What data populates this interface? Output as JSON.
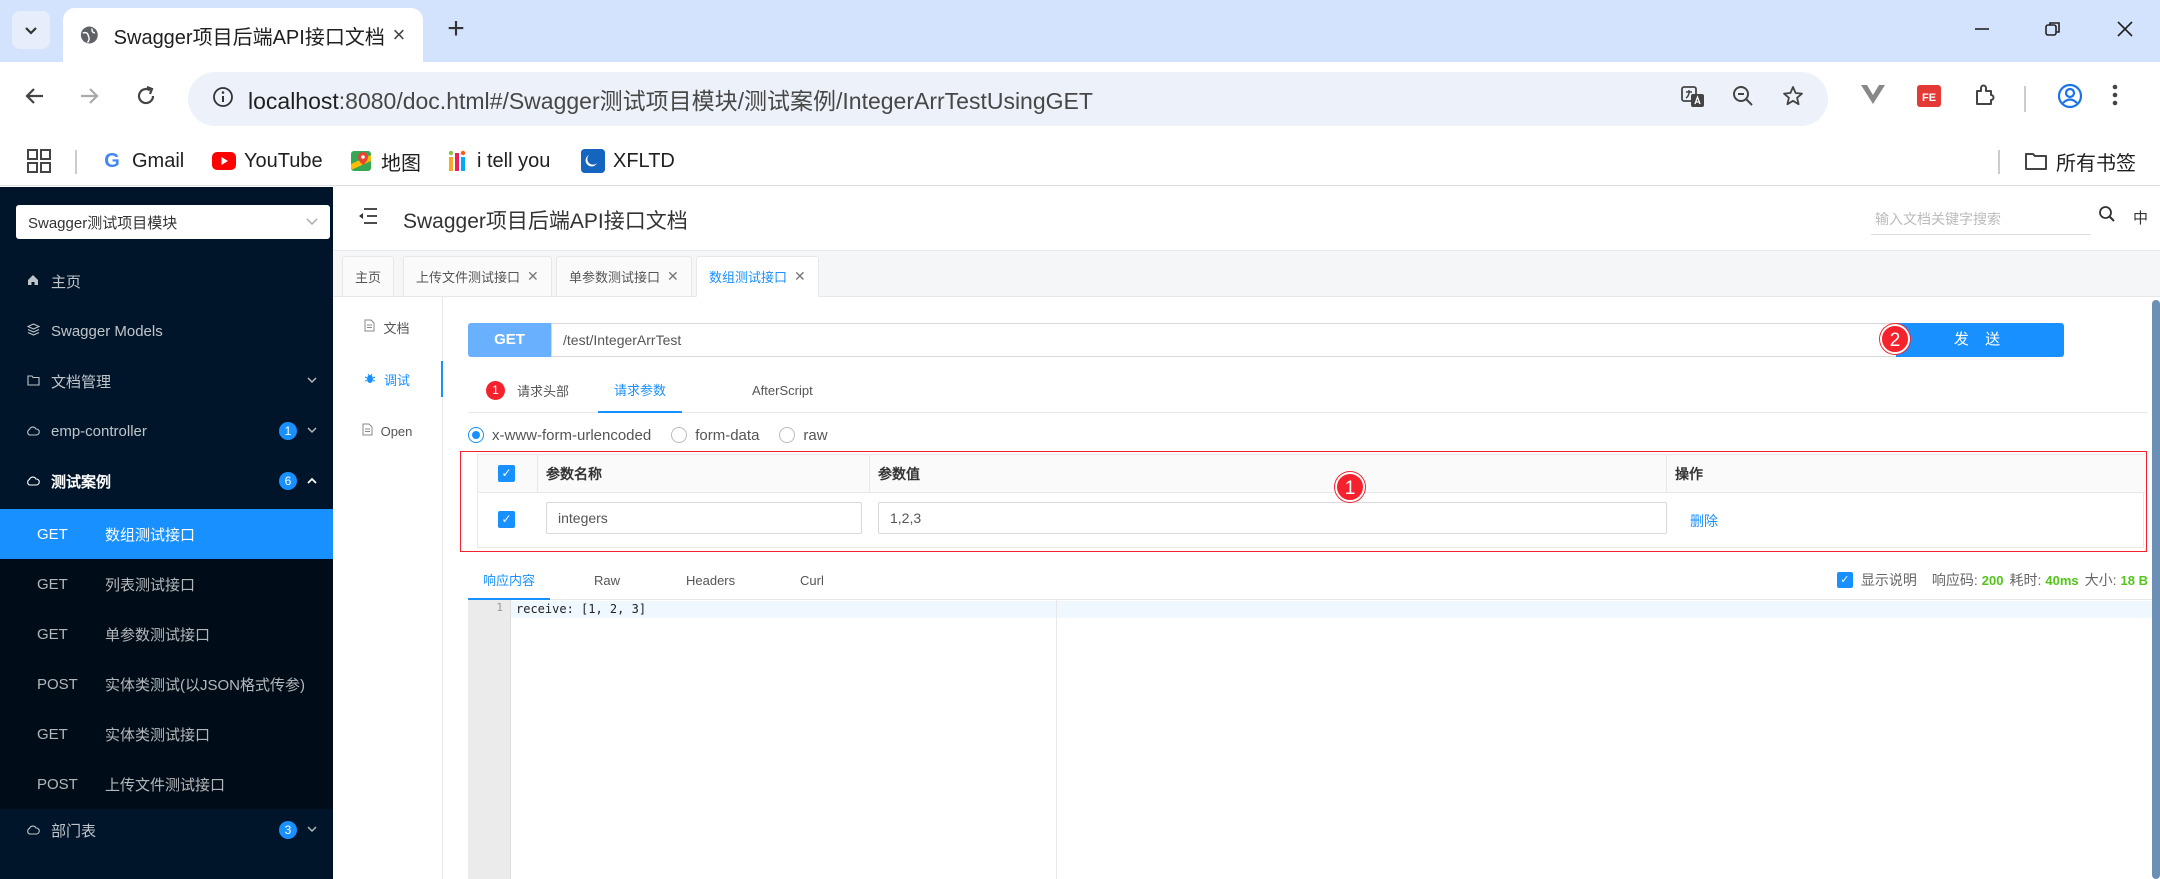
{
  "browser": {
    "tab_title": "Swagger项目后端API接口文档",
    "tab_close": "×",
    "new_tab": "+",
    "url_host": "localhost",
    "url_path": ":8080/doc.html#/Swagger测试项目模块/测试案例/IntegerArrTestUsingGET",
    "bookmarks": [
      "Gmail",
      "YouTube",
      "地图",
      "i tell you",
      "XFLTD"
    ],
    "all_bookmarks": "所有书签"
  },
  "sidebar": {
    "project_select": "Swagger测试项目模块",
    "items": [
      {
        "label": "主页",
        "icon": "home-icon"
      },
      {
        "label": "Swagger Models",
        "icon": "models-icon"
      },
      {
        "label": "文档管理",
        "icon": "folder-icon"
      },
      {
        "label": "emp-controller",
        "badge": "1"
      },
      {
        "label": "测试案例",
        "badge": "6"
      },
      {
        "label": "部门表",
        "badge": "3"
      }
    ],
    "sub_items": [
      {
        "method": "GET",
        "label": "数组测试接口"
      },
      {
        "method": "GET",
        "label": "列表测试接口"
      },
      {
        "method": "GET",
        "label": "单参数测试接口"
      },
      {
        "method": "POST",
        "label": "实体类测试(以JSON格式传参)"
      },
      {
        "method": "GET",
        "label": "实体类测试接口"
      },
      {
        "method": "POST",
        "label": "上传文件测试接口"
      }
    ]
  },
  "header": {
    "title": "Swagger项目后端API接口文档",
    "search_placeholder": "输入文档关键字搜索",
    "lang": "中"
  },
  "page_tabs": [
    "主页",
    "上传文件测试接口",
    "单参数测试接口",
    "数组测试接口"
  ],
  "left_nav": [
    "文档",
    "调试",
    "Open"
  ],
  "request": {
    "method": "GET",
    "url": "/test/IntegerArrTest",
    "send_label": "发 送",
    "marker_2": "2"
  },
  "sub_tabs": {
    "headers_badge": "1",
    "headers": "请求头部",
    "params": "请求参数",
    "afterscript": "AfterScript"
  },
  "body_types": [
    "x-www-form-urlencoded",
    "form-data",
    "raw"
  ],
  "param_table": {
    "col_name": "参数名称",
    "col_value": "参数值",
    "col_action": "操作",
    "row_name": "integers",
    "row_value": "1,2,3",
    "row_action": "删除",
    "marker_1": "1"
  },
  "response": {
    "tabs": [
      "响应内容",
      "Raw",
      "Headers",
      "Curl"
    ],
    "show_desc": "显示说明",
    "code_label": "响应码:",
    "code": "200",
    "time_label": "耗时:",
    "time": "40ms",
    "size_label": "大小:",
    "size": "18 B",
    "line_no": "1",
    "body": "receive: [1, 2, 3]"
  },
  "colors": {
    "primary": "#1890ff",
    "sidebar_bg": "#001529",
    "danger": "#f5222d",
    "success": "#52c41a"
  }
}
